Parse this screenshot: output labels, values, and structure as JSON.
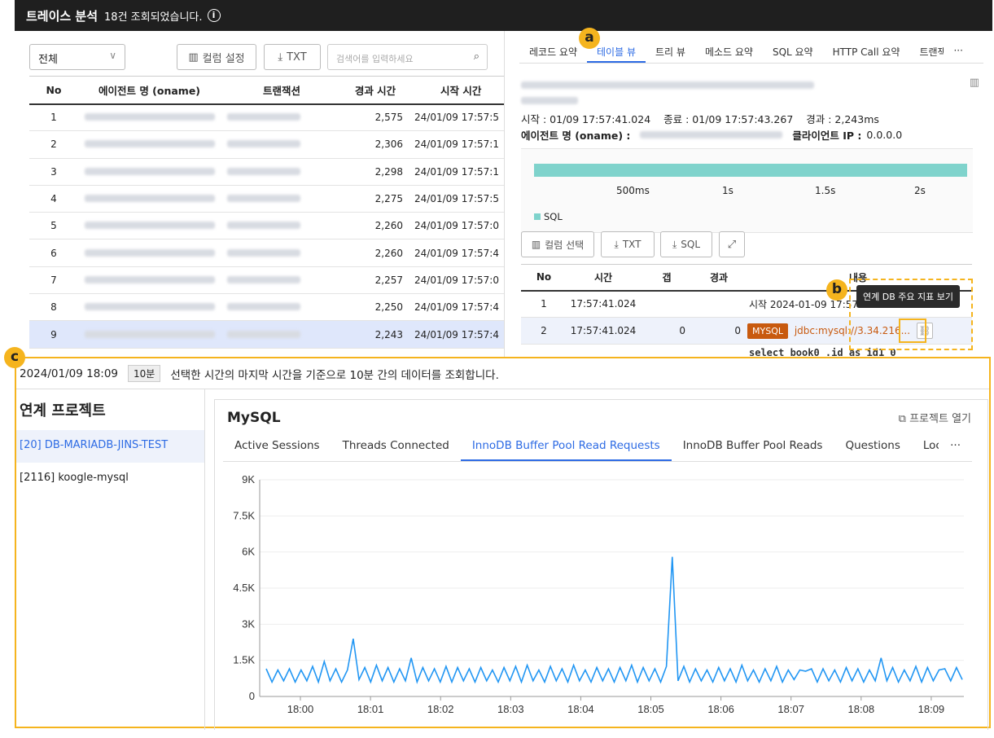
{
  "header": {
    "title": "트레이스 분석",
    "count_text": "18건 조회되었습니다.",
    "info_icon": "info-icon"
  },
  "left": {
    "filter_select": "전체",
    "column_button": "컬럼 설정",
    "txt_button": "TXT",
    "search_placeholder": "검색어를 입력하세요",
    "columns": [
      "No",
      "에이전트 명 (oname)",
      "트랜잭션",
      "경과 시간",
      "시작 시간"
    ],
    "rows": [
      {
        "no": "1",
        "elapsed": "2,575",
        "start": "24/01/09 17:57:5"
      },
      {
        "no": "2",
        "elapsed": "2,306",
        "start": "24/01/09 17:57:1"
      },
      {
        "no": "3",
        "elapsed": "2,298",
        "start": "24/01/09 17:57:1"
      },
      {
        "no": "4",
        "elapsed": "2,275",
        "start": "24/01/09 17:57:5"
      },
      {
        "no": "5",
        "elapsed": "2,260",
        "start": "24/01/09 17:57:0"
      },
      {
        "no": "6",
        "elapsed": "2,260",
        "start": "24/01/09 17:57:4"
      },
      {
        "no": "7",
        "elapsed": "2,257",
        "start": "24/01/09 17:57:0"
      },
      {
        "no": "8",
        "elapsed": "2,250",
        "start": "24/01/09 17:57:4"
      },
      {
        "no": "9",
        "elapsed": "2,243",
        "start": "24/01/09 17:57:4"
      }
    ]
  },
  "right": {
    "tabs": [
      "레코드 요약",
      "테이블 뷰",
      "트리 뷰",
      "메소드 요약",
      "SQL 요약",
      "HTTP Call 요약",
      "트랜잭"
    ],
    "more": "···",
    "start_label": "시작 :",
    "start_value": "01/09 17:57:41.024",
    "end_label": "종료 :",
    "end_value": "01/09 17:57:43.267",
    "elapsed_label": "경과 :",
    "elapsed_value": "2,243ms",
    "agent_label": "에이전트 명 (oname) :",
    "client_label": "클라이언트 IP :",
    "client_value": "0.0.0.0",
    "timeline_ticks": [
      "500ms",
      "1s",
      "1.5s",
      "2s"
    ],
    "legend": "SQL",
    "column_select": "컬럼 선택",
    "txt": "TXT",
    "sql": "SQL",
    "columns": [
      "No",
      "시간",
      "갭",
      "경과",
      "내용"
    ],
    "rows": [
      {
        "no": "1",
        "time": "17:57:41.024",
        "gap": "",
        "elapsed": "",
        "content": "시작  2024-01-09 17:57:41.024"
      },
      {
        "no": "2",
        "time": "17:57:41.024",
        "gap": "0",
        "elapsed": "0",
        "tag": "MYSQL",
        "content": "jdbc:mysql://3.34.216..."
      }
    ],
    "sql_snippet": "select book0_.id as id1_0_",
    "tooltip": "연계 DB 주요 지표 보기"
  },
  "markers": [
    "a",
    "b",
    "c"
  ],
  "bottom": {
    "datetime": "2024/01/09 18:09",
    "range_badge": "10분",
    "description": "선택한 시간의 마지막 시간을 기준으로 10분 간의 데이터를 조회합니다.",
    "side_title": "연계 프로젝트",
    "projects": [
      "[20] DB-MARIADB-JINS-TEST",
      "[2116] koogle-mysql"
    ],
    "panel_title": "MySQL",
    "open_project": "프로젝트 열기",
    "tabs": [
      "Active Sessions",
      "Threads Connected",
      "InnoDB Buffer Pool Read Requests",
      "InnoDB Buffer Pool Reads",
      "Questions",
      "Lock W"
    ],
    "tabs_more": "···"
  },
  "chart_data": {
    "type": "line",
    "title": "",
    "xlabel": "",
    "ylabel": "",
    "ylim": [
      0,
      9000
    ],
    "y_ticks": [
      "0",
      "1.5K",
      "3K",
      "4.5K",
      "6K",
      "7.5K",
      "9K"
    ],
    "x_ticks": [
      "18:00",
      "18:01",
      "18:02",
      "18:03",
      "18:04",
      "18:05",
      "18:06",
      "18:07",
      "18:08",
      "18:09"
    ],
    "color": "#2196f3",
    "series": [
      {
        "values": [
          1150,
          600,
          1100,
          650,
          1150,
          600,
          1100,
          650,
          1250,
          600,
          1450,
          650,
          1150,
          600,
          1100,
          2400,
          700,
          1200,
          600,
          1300,
          650,
          1200,
          600,
          1150,
          650,
          1600,
          600,
          1200,
          650,
          1150,
          600,
          1250,
          600,
          1200,
          650,
          1150,
          600,
          1200,
          650,
          1100,
          600,
          1200,
          650,
          1250,
          600,
          1300,
          650,
          1100,
          600,
          1250,
          650,
          1150,
          600,
          1300,
          650,
          1100,
          600,
          1200,
          650,
          1150,
          600,
          1200,
          650,
          1300,
          600,
          1200,
          650,
          1150,
          600,
          1250,
          5800,
          650,
          1250,
          600,
          1150,
          650,
          1100,
          600,
          1200,
          650,
          1150,
          600,
          1300,
          650,
          1100,
          600,
          1150,
          650,
          1250,
          600,
          1100,
          700,
          1100,
          1050,
          1150,
          600,
          1150,
          650,
          1100,
          600,
          1200,
          650,
          1150,
          600,
          1100,
          650,
          1600,
          650,
          1200,
          600,
          1100,
          650,
          1250,
          600,
          1200,
          650,
          1100,
          1150,
          650,
          1200,
          700
        ]
      }
    ]
  }
}
